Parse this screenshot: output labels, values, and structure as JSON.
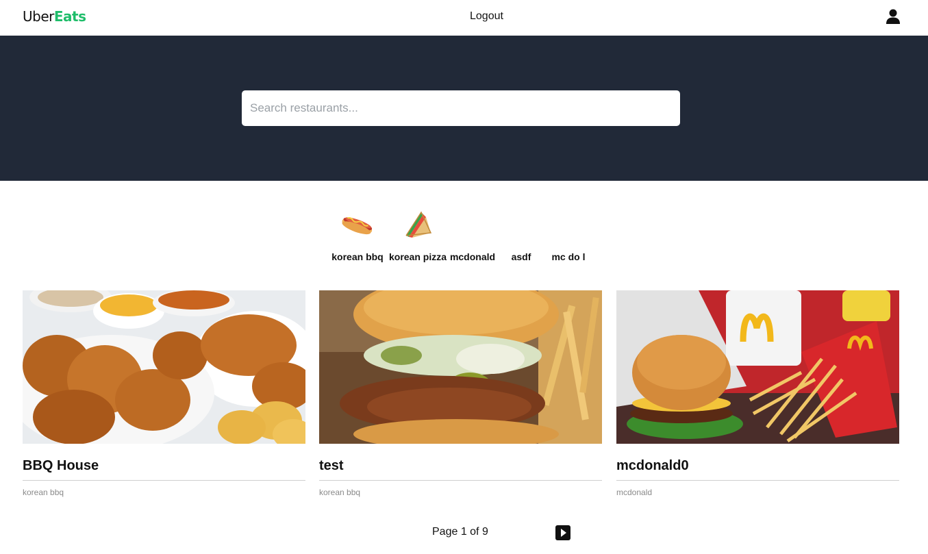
{
  "header": {
    "logo_uber": "Uber",
    "logo_eats": "Eats",
    "logout_label": "Logout",
    "user_icon": "user-icon"
  },
  "search": {
    "placeholder": "Search restaurants..."
  },
  "categories": [
    {
      "label": "korean bbq",
      "icon": "hotdog-icon"
    },
    {
      "label": "korean pizza",
      "icon": "sandwich-icon"
    },
    {
      "label": "mcdonald",
      "icon": ""
    },
    {
      "label": "asdf",
      "icon": ""
    },
    {
      "label": "mc do l",
      "icon": ""
    }
  ],
  "restaurants": [
    {
      "name": "BBQ House",
      "category": "korean bbq",
      "image": "fried-chicken-photo"
    },
    {
      "name": "test",
      "category": "korean bbq",
      "image": "chicken-burger-photo"
    },
    {
      "name": "mcdonald0",
      "category": "mcdonald",
      "image": "mcdonalds-meal-photo"
    }
  ],
  "pagination": {
    "text": "Page 1 of 9",
    "next_icon": "next-page-icon"
  },
  "colors": {
    "brand_green": "#1fbd6a",
    "hero_bg": "#212938"
  }
}
